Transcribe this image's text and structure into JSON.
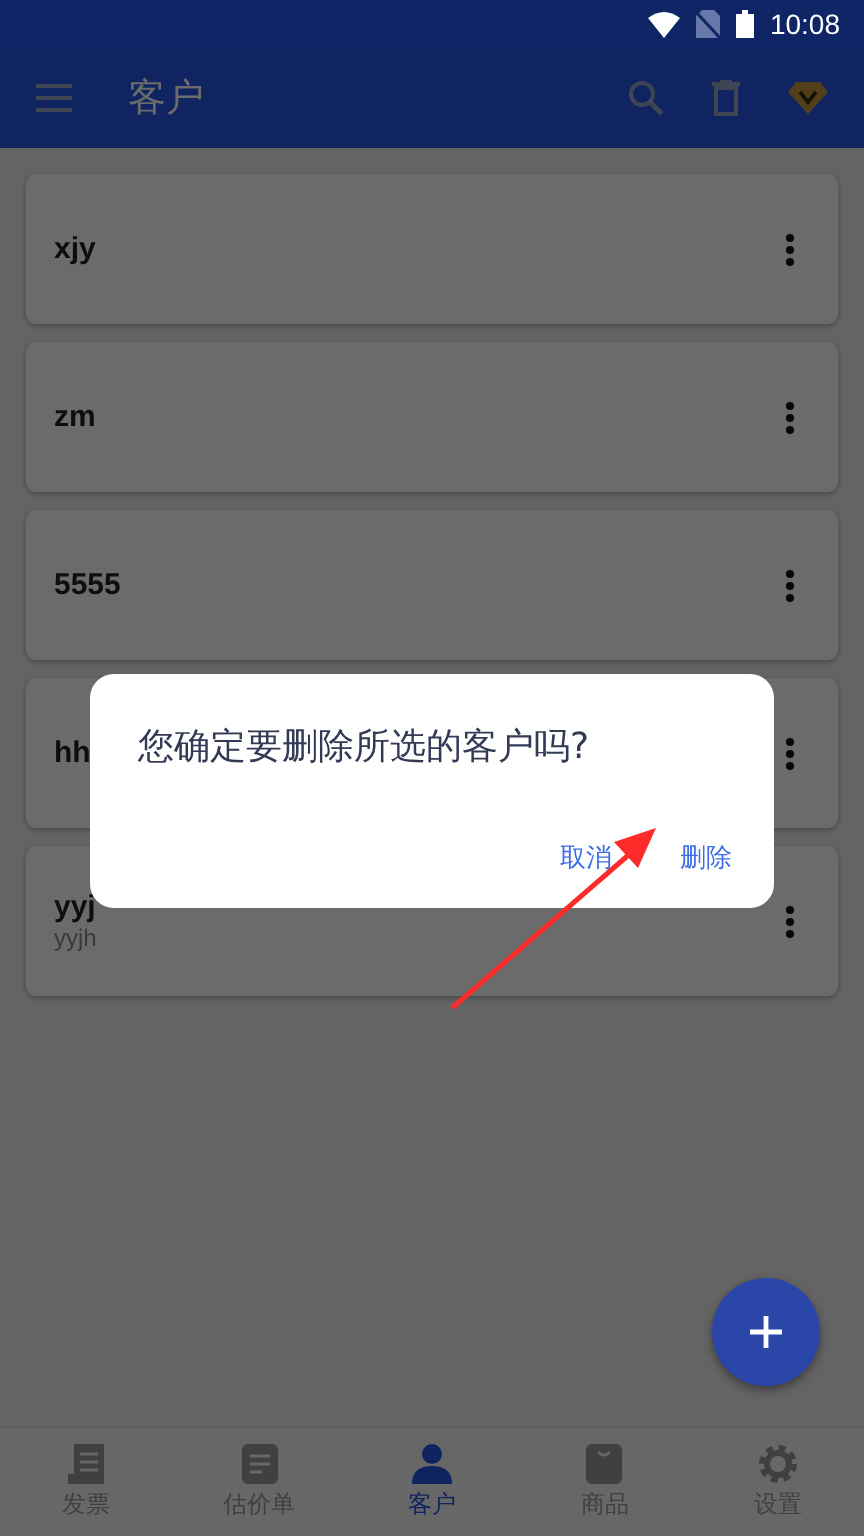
{
  "status_bar": {
    "time": "10:08"
  },
  "app_bar": {
    "title": "客户"
  },
  "customers": [
    {
      "name": "xjy"
    },
    {
      "name": "zm"
    },
    {
      "name": "5555"
    },
    {
      "name": "hh"
    },
    {
      "name": "yyj",
      "subtitle": "yyjh"
    }
  ],
  "dialog": {
    "message": "您确定要删除所选的客户吗?",
    "buttons": [
      "取消",
      "删除"
    ]
  },
  "bottom_nav": [
    {
      "label": "发票",
      "selected": false
    },
    {
      "label": "估价单",
      "selected": false
    },
    {
      "label": "客户",
      "selected": true
    },
    {
      "label": "商品",
      "selected": false
    },
    {
      "label": "设置",
      "selected": false
    }
  ]
}
